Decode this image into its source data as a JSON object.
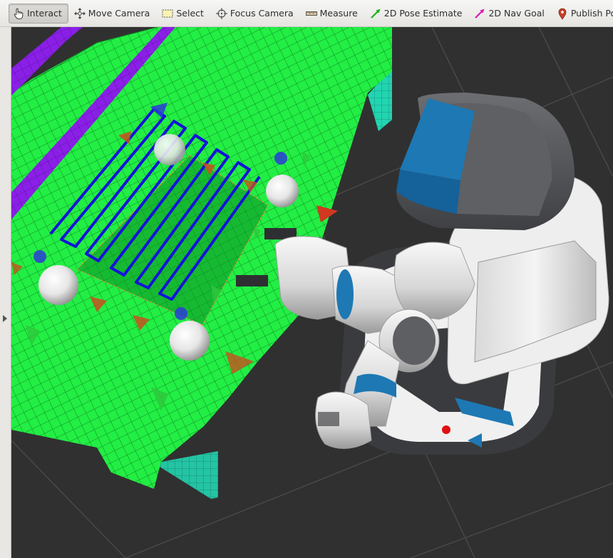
{
  "toolbar": {
    "tools": [
      {
        "label": "Interact",
        "icon": "hand-cursor-icon",
        "active": true
      },
      {
        "label": "Move Camera",
        "icon": "move-arrows-icon",
        "active": false
      },
      {
        "label": "Select",
        "icon": "dashed-rectangle-icon",
        "active": false
      },
      {
        "label": "Focus Camera",
        "icon": "crosshair-icon",
        "active": false
      },
      {
        "label": "Measure",
        "icon": "ruler-icon",
        "active": false
      },
      {
        "label": "2D Pose Estimate",
        "icon": "green-arrow-icon",
        "active": false
      },
      {
        "label": "2D Nav Goal",
        "icon": "magenta-arrow-icon",
        "active": false
      },
      {
        "label": "Publish Point",
        "icon": "map-pin-icon",
        "active": false
      }
    ]
  },
  "colors": {
    "viewport_background": "#303030",
    "grid_lines": "#4a4a4a",
    "table_voxels": "#22ee44",
    "table_side": "#22c8c8",
    "obstacle_voxels": "#8a1fe6",
    "grasp_pattern": "#1414d8",
    "marker_arrow_red": "#c8501e",
    "marker_arrow_green": "#2ec83c",
    "marker_arrow_blue": "#2a3cd8",
    "marker_sphere": "#f2f2f2",
    "robot_body": "#5a5c60",
    "robot_accent_blue": "#1e78b4",
    "robot_light": "#ebebeb",
    "status_led": "#e01010"
  }
}
